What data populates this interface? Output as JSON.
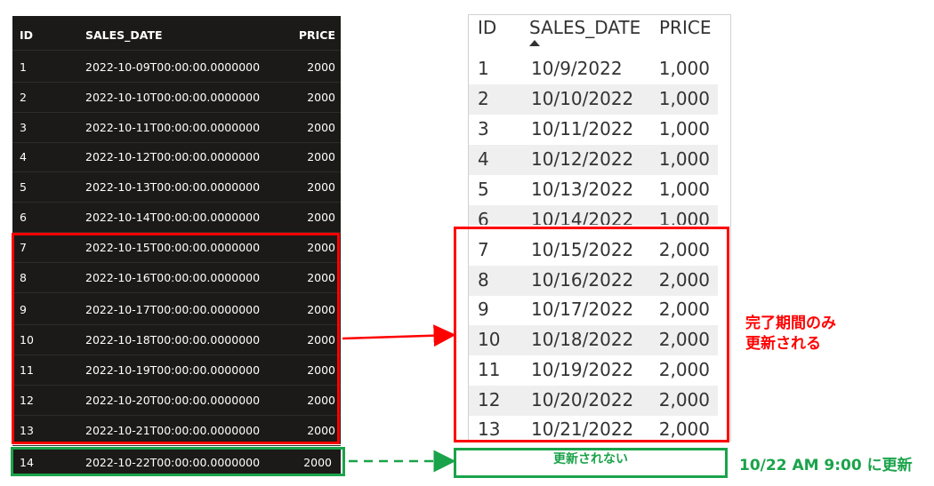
{
  "dark_table": {
    "headers": [
      "ID",
      "SALES_DATE",
      "PRICE"
    ],
    "rows": [
      {
        "id": "1",
        "date": "2022-10-09T00:00:00.0000000",
        "price": "2000"
      },
      {
        "id": "2",
        "date": "2022-10-10T00:00:00.0000000",
        "price": "2000"
      },
      {
        "id": "3",
        "date": "2022-10-11T00:00:00.0000000",
        "price": "2000"
      },
      {
        "id": "4",
        "date": "2022-10-12T00:00:00.0000000",
        "price": "2000"
      },
      {
        "id": "5",
        "date": "2022-10-13T00:00:00.0000000",
        "price": "2000"
      },
      {
        "id": "6",
        "date": "2022-10-14T00:00:00.0000000",
        "price": "2000"
      },
      {
        "id": "7",
        "date": "2022-10-15T00:00:00.0000000",
        "price": "2000"
      },
      {
        "id": "8",
        "date": "2022-10-16T00:00:00.0000000",
        "price": "2000"
      },
      {
        "id": "9",
        "date": "2022-10-17T00:00:00.0000000",
        "price": "2000"
      },
      {
        "id": "10",
        "date": "2022-10-18T00:00:00.0000000",
        "price": "2000"
      },
      {
        "id": "11",
        "date": "2022-10-19T00:00:00.0000000",
        "price": "2000"
      },
      {
        "id": "12",
        "date": "2022-10-20T00:00:00.0000000",
        "price": "2000"
      },
      {
        "id": "13",
        "date": "2022-10-21T00:00:00.0000000",
        "price": "2000"
      },
      {
        "id": "14",
        "date": "2022-10-22T00:00:00.0000000",
        "price": "2000"
      }
    ]
  },
  "light_table": {
    "headers": [
      "ID",
      "SALES_DATE",
      "PRICE"
    ],
    "sort_indicator": "sort-ascending",
    "rows": [
      {
        "id": "1",
        "date": "10/9/2022",
        "price": "1,000"
      },
      {
        "id": "2",
        "date": "10/10/2022",
        "price": "1,000"
      },
      {
        "id": "3",
        "date": "10/11/2022",
        "price": "1,000"
      },
      {
        "id": "4",
        "date": "10/12/2022",
        "price": "1,000"
      },
      {
        "id": "5",
        "date": "10/13/2022",
        "price": "1,000"
      },
      {
        "id": "6",
        "date": "10/14/2022",
        "price": "1,000"
      },
      {
        "id": "7",
        "date": "10/15/2022",
        "price": "2,000"
      },
      {
        "id": "8",
        "date": "10/16/2022",
        "price": "2,000"
      },
      {
        "id": "9",
        "date": "10/17/2022",
        "price": "2,000"
      },
      {
        "id": "10",
        "date": "10/18/2022",
        "price": "2,000"
      },
      {
        "id": "11",
        "date": "10/19/2022",
        "price": "2,000"
      },
      {
        "id": "12",
        "date": "10/20/2022",
        "price": "2,000"
      },
      {
        "id": "13",
        "date": "10/21/2022",
        "price": "2,000"
      }
    ]
  },
  "annotations": {
    "red_note_line1": "完了期間のみ",
    "red_note_line2": "更新される",
    "green_box_text": "更新されない",
    "green_note": "10/22 AM 9:00 に更新"
  },
  "colors": {
    "dark_bg": "#1b1a19",
    "red": "#ff0000",
    "green": "#1aa34a"
  }
}
